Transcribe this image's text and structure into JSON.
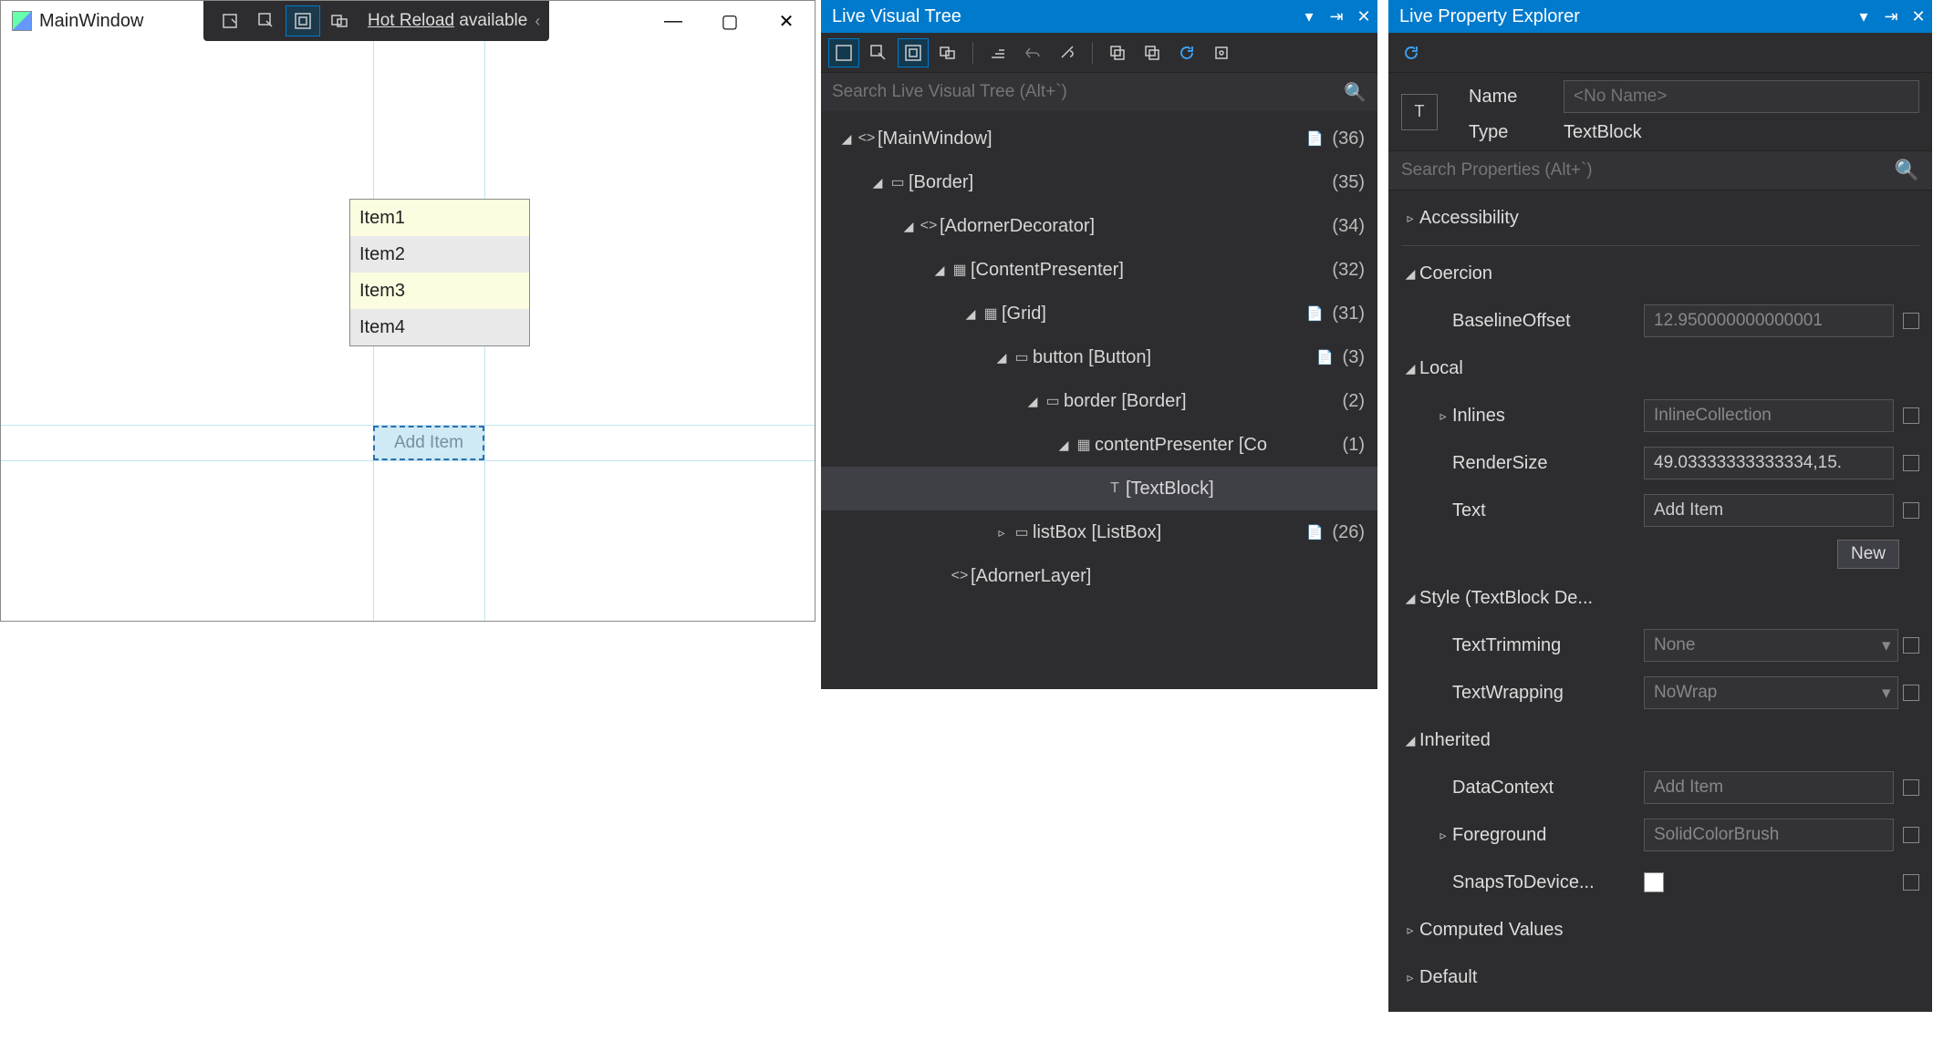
{
  "app": {
    "title": "MainWindow",
    "hotReload": {
      "label_u": "Hot Reload",
      "label_rest": " available"
    },
    "listItems": [
      "Item1",
      "Item2",
      "Item3",
      "Item4"
    ],
    "addButton": "Add Item"
  },
  "lvt": {
    "title": "Live Visual Tree",
    "searchPlaceholder": "Search Live Visual Tree (Alt+`)",
    "nodes": [
      {
        "depth": 0,
        "expanded": true,
        "glyph": "<>",
        "label": "[MainWindow]",
        "doc": true,
        "count": "(36)",
        "selected": false
      },
      {
        "depth": 1,
        "expanded": true,
        "glyph": "▭",
        "label": "[Border]",
        "doc": false,
        "count": "(35)",
        "selected": false
      },
      {
        "depth": 2,
        "expanded": true,
        "glyph": "<>",
        "label": "[AdornerDecorator]",
        "doc": false,
        "count": "(34)",
        "selected": false
      },
      {
        "depth": 3,
        "expanded": true,
        "glyph": "▦",
        "label": "[ContentPresenter]",
        "doc": false,
        "count": "(32)",
        "selected": false
      },
      {
        "depth": 4,
        "expanded": true,
        "glyph": "▦",
        "label": "[Grid]",
        "doc": true,
        "count": "(31)",
        "selected": false
      },
      {
        "depth": 5,
        "expanded": true,
        "glyph": "▭",
        "label": "button [Button]",
        "doc": true,
        "count": "(3)",
        "selected": false
      },
      {
        "depth": 6,
        "expanded": true,
        "glyph": "▭",
        "label": "border [Border]",
        "doc": false,
        "count": "(2)",
        "selected": false
      },
      {
        "depth": 7,
        "expanded": true,
        "glyph": "▦",
        "label": "contentPresenter [Co",
        "doc": false,
        "count": "(1)",
        "selected": false
      },
      {
        "depth": 8,
        "expanded": null,
        "glyph": "T",
        "label": "[TextBlock]",
        "doc": false,
        "count": "",
        "selected": true
      },
      {
        "depth": 5,
        "expanded": false,
        "glyph": "▭",
        "label": "listBox [ListBox]",
        "doc": true,
        "count": "(26)",
        "selected": false
      },
      {
        "depth": 3,
        "expanded": null,
        "glyph": "<>",
        "label": "[AdornerLayer]",
        "doc": false,
        "count": "",
        "selected": false
      }
    ]
  },
  "lpe": {
    "title": "Live Property Explorer",
    "header": {
      "nameLabel": "Name",
      "namePlaceholder": "<No Name>",
      "typeLabel": "Type",
      "typeValue": "TextBlock"
    },
    "searchPlaceholder": "Search Properties (Alt+`)",
    "newLabel": "New",
    "rows": [
      {
        "kind": "cat",
        "chev": "▹",
        "depth": 0,
        "label": "Accessibility"
      },
      {
        "kind": "div"
      },
      {
        "kind": "cat",
        "chev": "◢",
        "depth": 0,
        "label": "Coercion"
      },
      {
        "kind": "prop",
        "chev": "",
        "depth": 1,
        "label": "BaselineOffset",
        "value": "12.950000000000001",
        "dim": true,
        "sq": true
      },
      {
        "kind": "cat",
        "chev": "◢",
        "depth": 0,
        "label": "Local"
      },
      {
        "kind": "prop",
        "chev": "▹",
        "depth": 1,
        "label": "Inlines",
        "value": "InlineCollection",
        "dim": true,
        "sq": true
      },
      {
        "kind": "prop",
        "chev": "",
        "depth": 1,
        "label": "RenderSize",
        "value": "49.03333333333334,15.",
        "dim": false,
        "sq": true
      },
      {
        "kind": "prop",
        "chev": "",
        "depth": 1,
        "label": "Text",
        "value": "Add Item",
        "dim": false,
        "sq": true
      },
      {
        "kind": "newbtn"
      },
      {
        "kind": "cat",
        "chev": "◢",
        "depth": 0,
        "label": "Style (TextBlock De..."
      },
      {
        "kind": "prop",
        "chev": "",
        "depth": 1,
        "label": "TextTrimming",
        "value": "None",
        "dim": true,
        "sq": true,
        "dd": true
      },
      {
        "kind": "prop",
        "chev": "",
        "depth": 1,
        "label": "TextWrapping",
        "value": "NoWrap",
        "dim": true,
        "sq": true,
        "dd": true
      },
      {
        "kind": "cat",
        "chev": "◢",
        "depth": 0,
        "label": "Inherited"
      },
      {
        "kind": "prop",
        "chev": "",
        "depth": 1,
        "label": "DataContext",
        "value": "Add Item",
        "dim": true,
        "sq": true
      },
      {
        "kind": "prop",
        "chev": "▹",
        "depth": 1,
        "label": "Foreground",
        "value": "SolidColorBrush",
        "dim": true,
        "sq": true
      },
      {
        "kind": "prop",
        "chev": "",
        "depth": 1,
        "label": "SnapsToDevice...",
        "value": "",
        "swatch": true,
        "sq": true
      },
      {
        "kind": "cat",
        "chev": "▹",
        "depth": 0,
        "label": "Computed Values"
      },
      {
        "kind": "cat",
        "chev": "▹",
        "depth": 0,
        "label": "Default"
      }
    ]
  }
}
